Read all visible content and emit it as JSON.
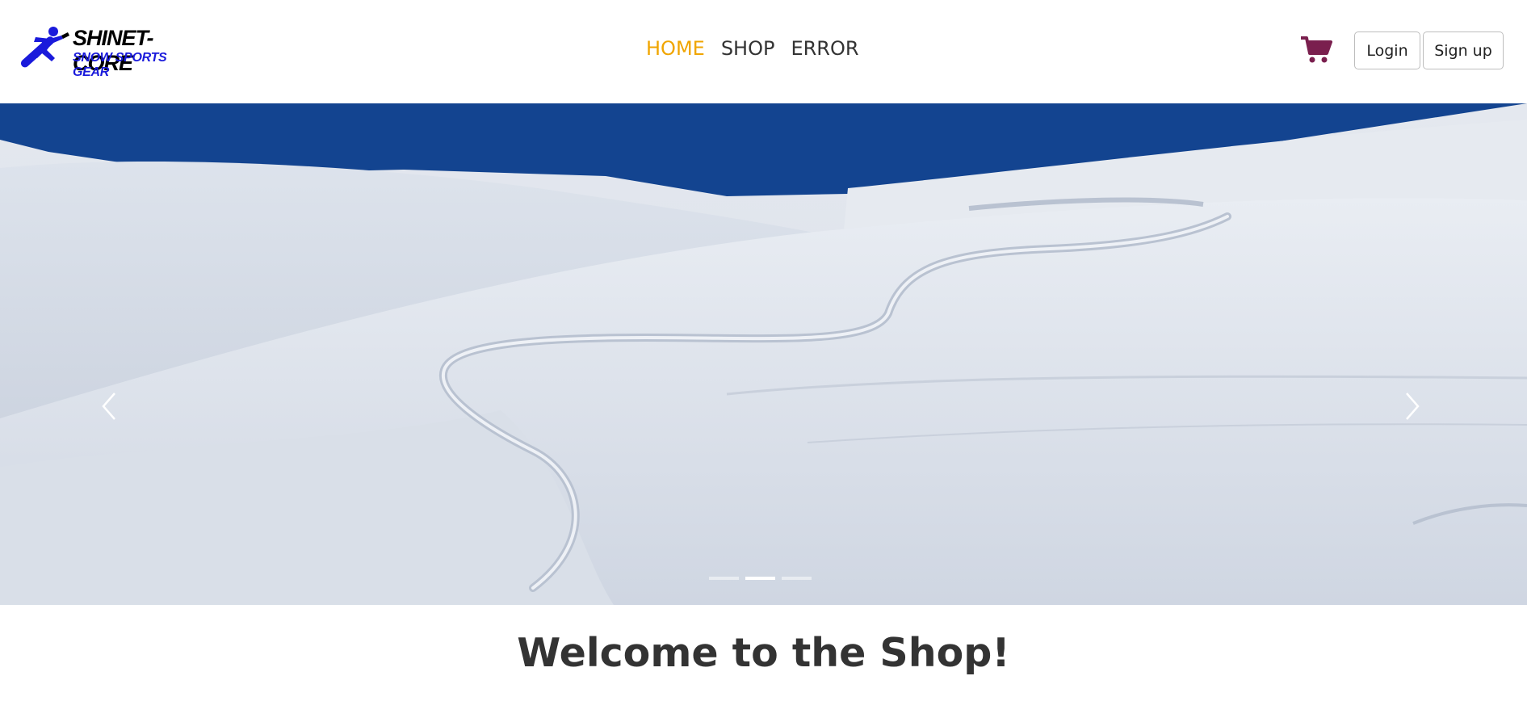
{
  "brand": {
    "title": "SHINET-CORE",
    "subtitle": "SNOW SPORTS GEAR",
    "logo_icon": "snowboarder-icon",
    "title_color": "#000000",
    "subtitle_color": "#1a1adb"
  },
  "nav": {
    "items": [
      {
        "label": "HOME",
        "active": true
      },
      {
        "label": "SHOP",
        "active": false
      },
      {
        "label": "ERROR",
        "active": false
      }
    ],
    "active_color": "#f0a500",
    "text_color": "#333333"
  },
  "header": {
    "cart_icon": "shopping-cart-icon",
    "cart_color": "#7a1f4e",
    "login_label": "Login",
    "signup_label": "Sign up"
  },
  "carousel": {
    "slide_count": 3,
    "active_index": 1,
    "prev_icon": "chevron-left-icon",
    "next_icon": "chevron-right-icon",
    "sky_color": "#134490"
  },
  "main": {
    "welcome_text": "Welcome to the Shop!"
  }
}
